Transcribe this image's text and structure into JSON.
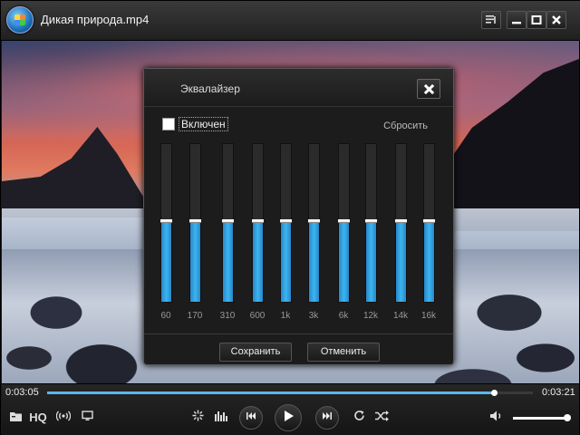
{
  "window": {
    "title": "Дикая природа.mp4",
    "icons": [
      "app-logo",
      "playlist-icon",
      "minimize-icon",
      "maximize-icon",
      "close-icon"
    ]
  },
  "equalizer": {
    "title": "Эквалайзер",
    "enabled_label": "Включен",
    "enabled": false,
    "reset_label": "Сбросить",
    "bands": [
      {
        "label": "60",
        "level": 0.5
      },
      {
        "label": "170",
        "level": 0.5
      },
      {
        "label": "310",
        "level": 0.5
      },
      {
        "label": "600",
        "level": 0.5
      },
      {
        "label": "1k",
        "level": 0.5
      },
      {
        "label": "3k",
        "level": 0.5
      },
      {
        "label": "6k",
        "level": 0.5
      },
      {
        "label": "12k",
        "level": 0.5
      },
      {
        "label": "14k",
        "level": 0.5
      },
      {
        "label": "16k",
        "level": 0.5
      }
    ],
    "save_label": "Сохранить",
    "cancel_label": "Отменить",
    "accent": "#3ab6f0"
  },
  "player": {
    "current_time": "0:03:05",
    "total_time": "0:03:21",
    "progress": 0.92,
    "hq_label": "HQ",
    "volume": 1.0
  }
}
